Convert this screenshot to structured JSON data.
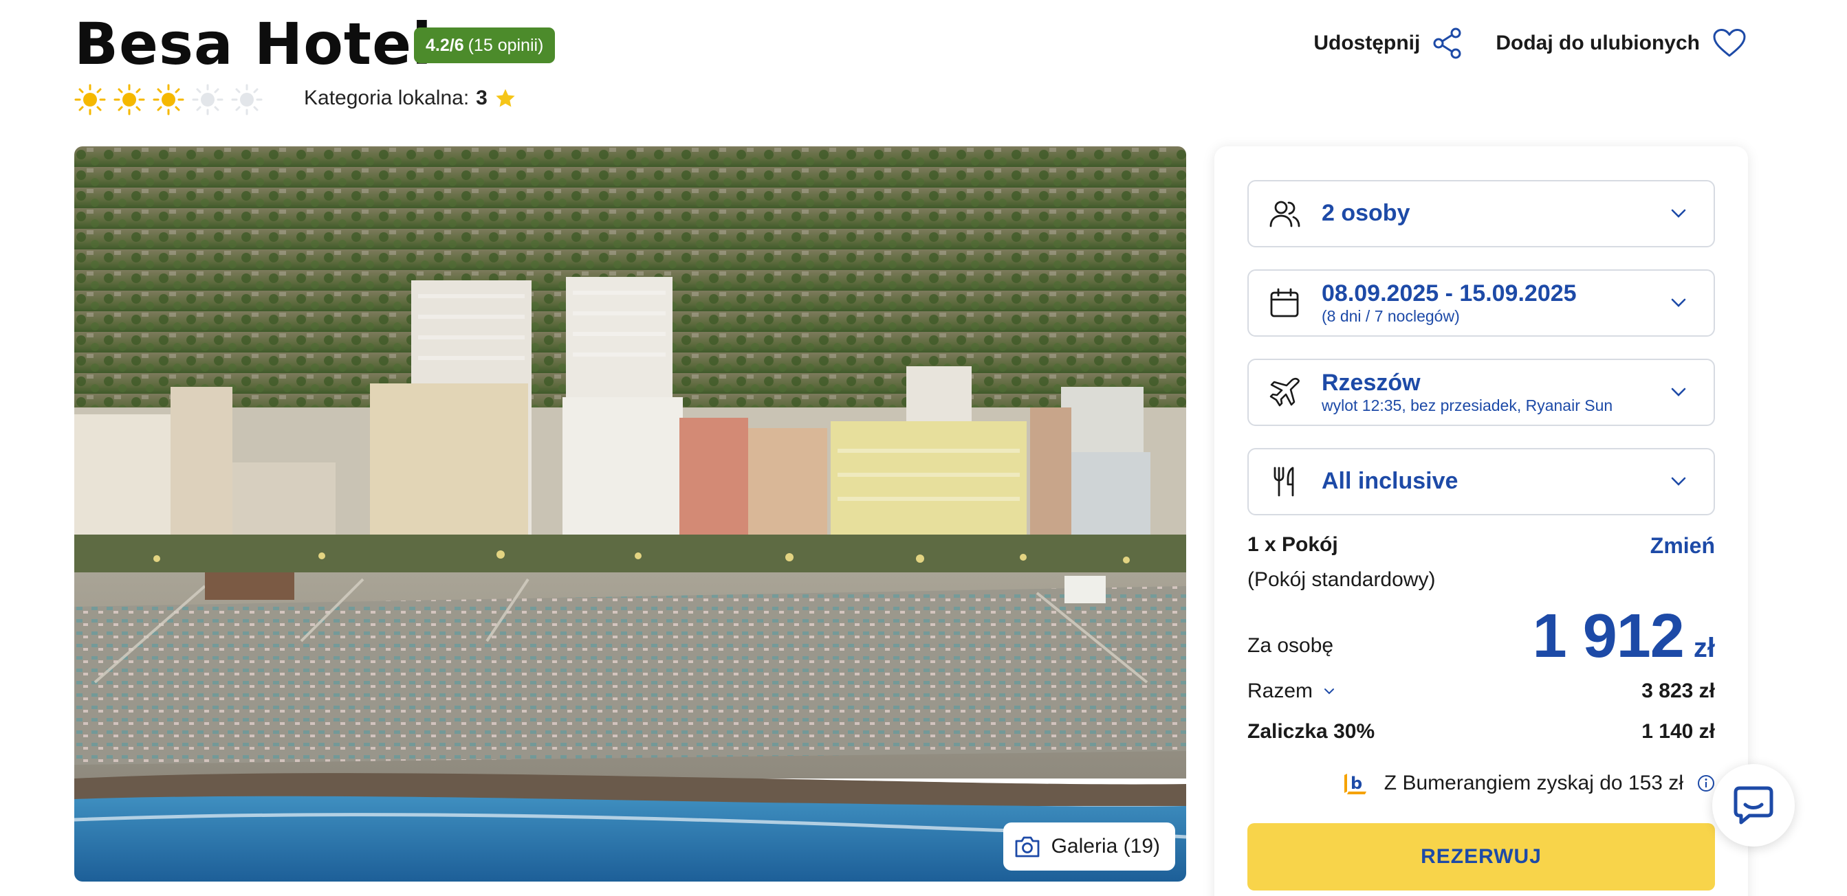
{
  "hotel": {
    "name": "Besa Hotel",
    "rating_score": "4.2/6",
    "rating_count": "(15 opinii)",
    "stars_filled": 3,
    "stars_total": 5,
    "category_label": "Kategoria lokalna:",
    "category_value": "3"
  },
  "header_actions": {
    "share_label": "Udostępnij",
    "favorite_label": "Dodaj do ulubionych"
  },
  "gallery": {
    "button_label": "Galeria (19)"
  },
  "booking": {
    "people": {
      "main": "2 osoby"
    },
    "dates": {
      "main": "08.09.2025 - 15.09.2025",
      "sub": "(8 dni / 7 noclegów)"
    },
    "flight": {
      "main": "Rzeszów",
      "sub": "wylot 12:35, bez przesiadek, Ryanair Sun"
    },
    "board": {
      "main": "All inclusive"
    },
    "room_count_label": "1 x Pokój",
    "room_type": "(Pokój standardowy)",
    "change_label": "Zmień",
    "per_person_label": "Za osobę",
    "per_person_price": "1 912",
    "currency": "zł",
    "total_label": "Razem",
    "total_value": "3 823 zł",
    "deposit_label": "Zaliczka 30%",
    "deposit_value": "1 140 zł",
    "bumerang_text": "Z Bumerangiem zyskaj do 153 zł",
    "reserve_label": "REZERWUJ"
  },
  "colors": {
    "brand_blue": "#1d4aa7",
    "rating_green": "#4c8b2b",
    "cta_yellow": "#f8d44a",
    "star_gold": "#f5b800"
  }
}
